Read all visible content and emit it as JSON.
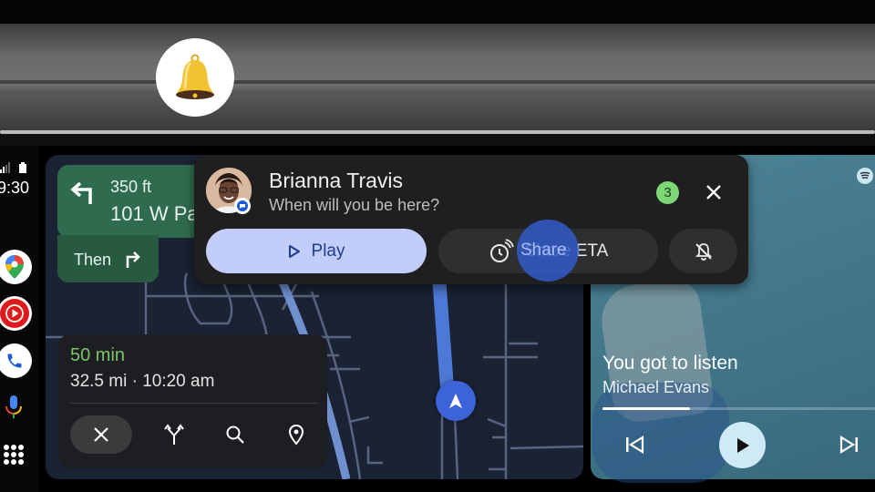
{
  "overlay": {
    "bell_icon": "bell-icon"
  },
  "rail": {
    "time": "9:30",
    "status_icons": [
      "signal-icon",
      "battery-icon"
    ],
    "apps": [
      {
        "name": "Google Maps",
        "icon": "maps-icon"
      },
      {
        "name": "YouTube Music",
        "icon": "youtube-music-icon"
      },
      {
        "name": "Phone",
        "icon": "phone-icon"
      }
    ],
    "mic_icon": "microphone-icon",
    "launcher_icon": "app-grid-icon"
  },
  "navigation": {
    "maneuver_icon": "turn-left-icon",
    "distance": "350 ft",
    "street": "101 W Pacific",
    "then_label": "Then",
    "then_icon": "turn-right-icon"
  },
  "trip": {
    "eta_duration": "50 min",
    "details": "32.5 mi · 10:20 am",
    "eta_color": "#7dc466",
    "actions": [
      "close",
      "alternate-routes",
      "search",
      "places"
    ]
  },
  "notification": {
    "sender": "Brianna Travis",
    "message": "When will you be here?",
    "unread_count": "3",
    "buttons": {
      "play": "Play",
      "share_eta": "Share ETA",
      "mute": "mute-notification"
    }
  },
  "media": {
    "source": "Spotify",
    "title": "You got to listen",
    "artist": "Michael Evans",
    "progress_percent": 32,
    "controls": [
      "previous",
      "play",
      "next"
    ]
  }
}
